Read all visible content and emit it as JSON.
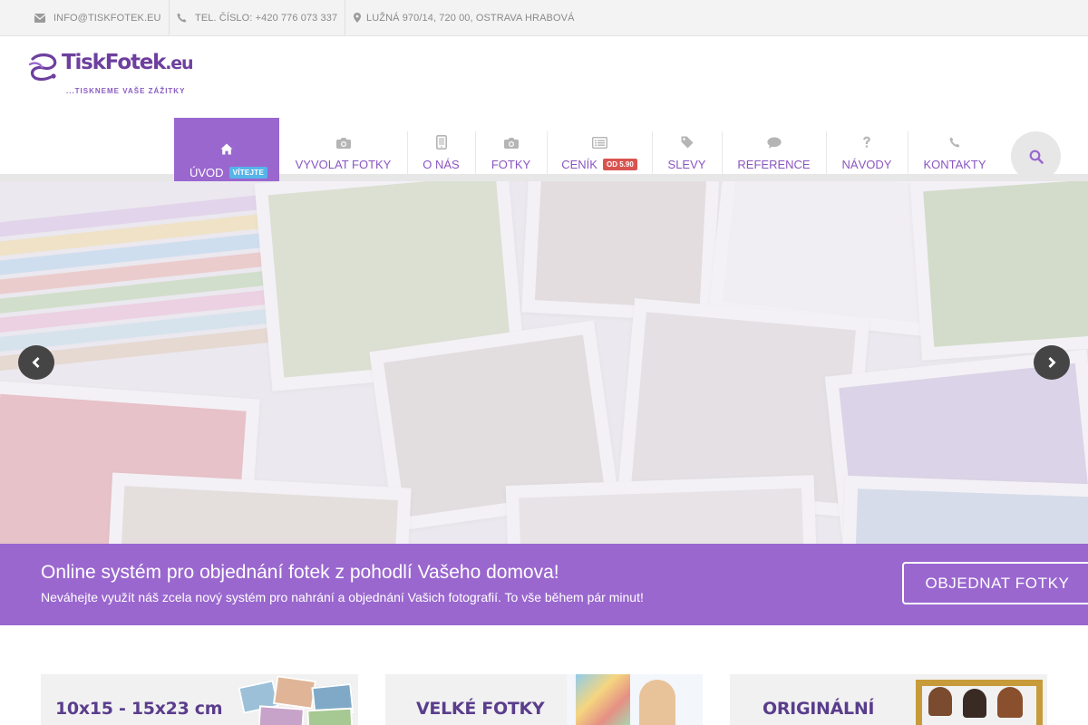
{
  "topbar": {
    "email": "INFO@TISKFOTEK.EU",
    "phone": "TEL. ČÍSLO: +420 776 073 337",
    "address": "LUŽNÁ 970/14, 720 00, OSTRAVA HRABOVÁ"
  },
  "logo": {
    "brand": "TiskFotek",
    "tld": ".eu",
    "tagline": "...TISKNEME VAŠE ZÁŽITKY"
  },
  "nav": {
    "home": {
      "label": "ÚVOD",
      "badge": "VÍTEJTE",
      "icon": "home-icon"
    },
    "items": [
      {
        "label": "VYVOLAT FOTKY",
        "icon": "camera-icon"
      },
      {
        "label": "O NÁS",
        "icon": "tablet-icon"
      },
      {
        "label": "FOTKY",
        "icon": "camera-icon"
      },
      {
        "label": "CENÍK",
        "badge": "OD 5.90",
        "icon": "list-icon"
      },
      {
        "label": "SLEVY",
        "icon": "tag-icon"
      },
      {
        "label": "REFERENCE",
        "icon": "comment-icon"
      },
      {
        "label": "NÁVODY",
        "icon": "question-icon"
      },
      {
        "label": "KONTAKTY",
        "icon": "phone-icon"
      }
    ],
    "search_icon": "search-icon"
  },
  "hero": {
    "prev_icon": "chevron-left-icon",
    "next_icon": "chevron-right-icon"
  },
  "cta": {
    "title": "Online systém pro objednání fotek z pohodlí Vašeho domova!",
    "subtitle": "Neváhejte využít náš zcela nový systém pro nahrání a objednání Vašich fotografií. To vše během pár minut!",
    "button": "OBJEDNAT FOTKY"
  },
  "cards": [
    {
      "title": "10x15 - 15x23 cm"
    },
    {
      "title": "VELKÉ FOTKY"
    },
    {
      "title": "ORIGINÁLNÍ"
    }
  ],
  "colors": {
    "brand_purple": "#9a67cf",
    "brand_dark_purple": "#6b3f99",
    "badge_blue": "#56b4e8",
    "badge_red": "#d9534f",
    "nav_text": "#8a55c0"
  }
}
